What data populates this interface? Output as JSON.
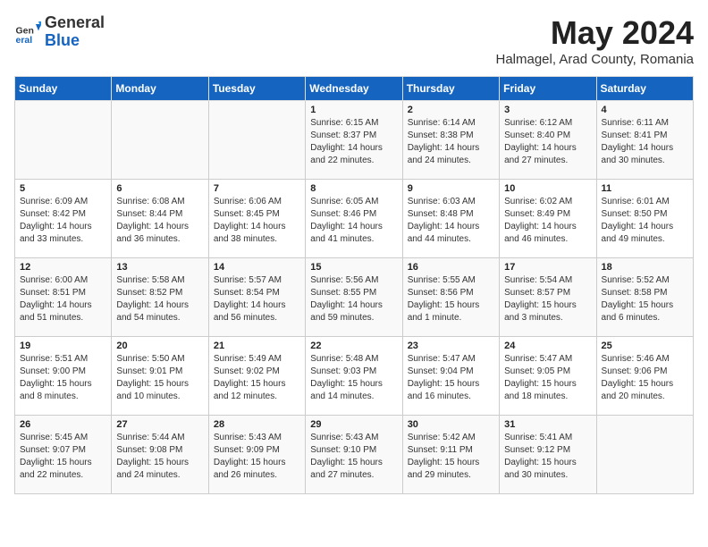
{
  "header": {
    "logo_general": "General",
    "logo_blue": "Blue",
    "month_title": "May 2024",
    "subtitle": "Halmagel, Arad County, Romania"
  },
  "days_of_week": [
    "Sunday",
    "Monday",
    "Tuesday",
    "Wednesday",
    "Thursday",
    "Friday",
    "Saturday"
  ],
  "weeks": [
    [
      {
        "day": "",
        "info": ""
      },
      {
        "day": "",
        "info": ""
      },
      {
        "day": "",
        "info": ""
      },
      {
        "day": "1",
        "info": "Sunrise: 6:15 AM\nSunset: 8:37 PM\nDaylight: 14 hours\nand 22 minutes."
      },
      {
        "day": "2",
        "info": "Sunrise: 6:14 AM\nSunset: 8:38 PM\nDaylight: 14 hours\nand 24 minutes."
      },
      {
        "day": "3",
        "info": "Sunrise: 6:12 AM\nSunset: 8:40 PM\nDaylight: 14 hours\nand 27 minutes."
      },
      {
        "day": "4",
        "info": "Sunrise: 6:11 AM\nSunset: 8:41 PM\nDaylight: 14 hours\nand 30 minutes."
      }
    ],
    [
      {
        "day": "5",
        "info": "Sunrise: 6:09 AM\nSunset: 8:42 PM\nDaylight: 14 hours\nand 33 minutes."
      },
      {
        "day": "6",
        "info": "Sunrise: 6:08 AM\nSunset: 8:44 PM\nDaylight: 14 hours\nand 36 minutes."
      },
      {
        "day": "7",
        "info": "Sunrise: 6:06 AM\nSunset: 8:45 PM\nDaylight: 14 hours\nand 38 minutes."
      },
      {
        "day": "8",
        "info": "Sunrise: 6:05 AM\nSunset: 8:46 PM\nDaylight: 14 hours\nand 41 minutes."
      },
      {
        "day": "9",
        "info": "Sunrise: 6:03 AM\nSunset: 8:48 PM\nDaylight: 14 hours\nand 44 minutes."
      },
      {
        "day": "10",
        "info": "Sunrise: 6:02 AM\nSunset: 8:49 PM\nDaylight: 14 hours\nand 46 minutes."
      },
      {
        "day": "11",
        "info": "Sunrise: 6:01 AM\nSunset: 8:50 PM\nDaylight: 14 hours\nand 49 minutes."
      }
    ],
    [
      {
        "day": "12",
        "info": "Sunrise: 6:00 AM\nSunset: 8:51 PM\nDaylight: 14 hours\nand 51 minutes."
      },
      {
        "day": "13",
        "info": "Sunrise: 5:58 AM\nSunset: 8:52 PM\nDaylight: 14 hours\nand 54 minutes."
      },
      {
        "day": "14",
        "info": "Sunrise: 5:57 AM\nSunset: 8:54 PM\nDaylight: 14 hours\nand 56 minutes."
      },
      {
        "day": "15",
        "info": "Sunrise: 5:56 AM\nSunset: 8:55 PM\nDaylight: 14 hours\nand 59 minutes."
      },
      {
        "day": "16",
        "info": "Sunrise: 5:55 AM\nSunset: 8:56 PM\nDaylight: 15 hours\nand 1 minute."
      },
      {
        "day": "17",
        "info": "Sunrise: 5:54 AM\nSunset: 8:57 PM\nDaylight: 15 hours\nand 3 minutes."
      },
      {
        "day": "18",
        "info": "Sunrise: 5:52 AM\nSunset: 8:58 PM\nDaylight: 15 hours\nand 6 minutes."
      }
    ],
    [
      {
        "day": "19",
        "info": "Sunrise: 5:51 AM\nSunset: 9:00 PM\nDaylight: 15 hours\nand 8 minutes."
      },
      {
        "day": "20",
        "info": "Sunrise: 5:50 AM\nSunset: 9:01 PM\nDaylight: 15 hours\nand 10 minutes."
      },
      {
        "day": "21",
        "info": "Sunrise: 5:49 AM\nSunset: 9:02 PM\nDaylight: 15 hours\nand 12 minutes."
      },
      {
        "day": "22",
        "info": "Sunrise: 5:48 AM\nSunset: 9:03 PM\nDaylight: 15 hours\nand 14 minutes."
      },
      {
        "day": "23",
        "info": "Sunrise: 5:47 AM\nSunset: 9:04 PM\nDaylight: 15 hours\nand 16 minutes."
      },
      {
        "day": "24",
        "info": "Sunrise: 5:47 AM\nSunset: 9:05 PM\nDaylight: 15 hours\nand 18 minutes."
      },
      {
        "day": "25",
        "info": "Sunrise: 5:46 AM\nSunset: 9:06 PM\nDaylight: 15 hours\nand 20 minutes."
      }
    ],
    [
      {
        "day": "26",
        "info": "Sunrise: 5:45 AM\nSunset: 9:07 PM\nDaylight: 15 hours\nand 22 minutes."
      },
      {
        "day": "27",
        "info": "Sunrise: 5:44 AM\nSunset: 9:08 PM\nDaylight: 15 hours\nand 24 minutes."
      },
      {
        "day": "28",
        "info": "Sunrise: 5:43 AM\nSunset: 9:09 PM\nDaylight: 15 hours\nand 26 minutes."
      },
      {
        "day": "29",
        "info": "Sunrise: 5:43 AM\nSunset: 9:10 PM\nDaylight: 15 hours\nand 27 minutes."
      },
      {
        "day": "30",
        "info": "Sunrise: 5:42 AM\nSunset: 9:11 PM\nDaylight: 15 hours\nand 29 minutes."
      },
      {
        "day": "31",
        "info": "Sunrise: 5:41 AM\nSunset: 9:12 PM\nDaylight: 15 hours\nand 30 minutes."
      },
      {
        "day": "",
        "info": ""
      }
    ]
  ]
}
